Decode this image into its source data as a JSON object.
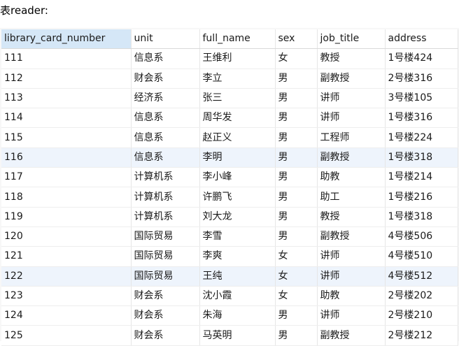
{
  "caption": "表reader:",
  "columns": [
    "library_card_number",
    "unit",
    "full_name",
    "sex",
    "job_title",
    "address"
  ],
  "rows": [
    [
      "111",
      "信息系",
      "王维利",
      "女",
      "教授",
      "1号楼424"
    ],
    [
      "112",
      "财会系",
      "李立",
      "男",
      "副教授",
      "2号楼316"
    ],
    [
      "113",
      "经济系",
      "张三",
      "男",
      "讲师",
      "3号楼105"
    ],
    [
      "114",
      "信息系",
      "周华发",
      "男",
      "讲师",
      "1号楼316"
    ],
    [
      "115",
      "信息系",
      "赵正义",
      "男",
      "工程师",
      "1号楼224"
    ],
    [
      "116",
      "信息系",
      "李明",
      "男",
      "副教授",
      "1号楼318"
    ],
    [
      "117",
      "计算机系",
      "李小峰",
      "男",
      "助教",
      "1号楼214"
    ],
    [
      "118",
      "计算机系",
      "许鹏飞",
      "男",
      "助工",
      "1号楼216"
    ],
    [
      "119",
      "计算机系",
      "刘大龙",
      "男",
      "教授",
      "1号楼318"
    ],
    [
      "120",
      "国际贸易",
      "李雪",
      "男",
      "副教授",
      "4号楼506"
    ],
    [
      "121",
      "国际贸易",
      "李爽",
      "女",
      "讲师",
      "4号楼510"
    ],
    [
      "122",
      "国际贸易",
      "王纯",
      "女",
      "讲师",
      "4号楼512"
    ],
    [
      "123",
      "财会系",
      "沈小霞",
      "女",
      "助教",
      "2号楼202"
    ],
    [
      "124",
      "财会系",
      "朱海",
      "男",
      "讲师",
      "2号楼210"
    ],
    [
      "125",
      "财会系",
      "马英明",
      "男",
      "副教授",
      "2号楼212"
    ]
  ],
  "highlighted_rows": [
    "116",
    "122"
  ]
}
